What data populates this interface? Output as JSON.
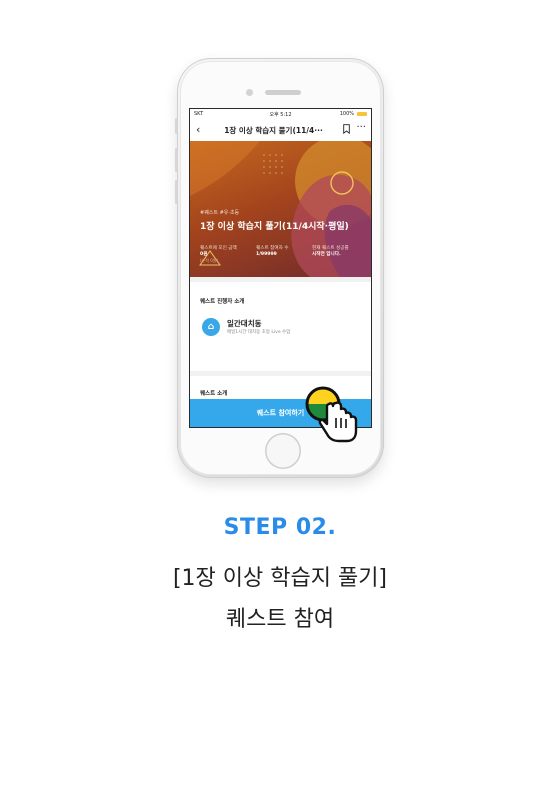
{
  "status_bar": {
    "carrier": "SKT",
    "time": "오후 5:12",
    "battery": "100%"
  },
  "nav": {
    "back_icon": "chevron-left-icon",
    "title": "1장 이상 학습지 풀기(11/4···",
    "bookmark_icon": "bookmark-icon",
    "more": "···"
  },
  "hero": {
    "tags": "#퀘스트 #유·초등",
    "title": "1장 이상 학습지 풀기(11/4시작·평일)",
    "stats": [
      {
        "label": "퀘스트에 모인 금액",
        "value": "0원",
        "sub": "(누적 0원)"
      },
      {
        "label": "퀘스트 참여자 수",
        "value": "1/99999",
        "sub": ""
      },
      {
        "label": "현재 퀘스트 성공률",
        "value": "시작전 입니다.",
        "sub": ""
      }
    ]
  },
  "host_section": {
    "label": "퀘스트 진행자 소개",
    "icon": "home-icon",
    "name": "일간대치동",
    "desc": "매일1시간 대치동 초등 Live 수업"
  },
  "about_section": {
    "label": "퀘스트 소개"
  },
  "cta": {
    "label": "퀘스트 참여하기"
  },
  "caption": {
    "step": "STEP 02.",
    "line1": "[1장 이상 학습지 풀기]",
    "line2": "퀘스트 참여"
  },
  "colors": {
    "accent": "#2a8ce8",
    "cta": "#34a8ea",
    "hero": "#a4441d"
  }
}
